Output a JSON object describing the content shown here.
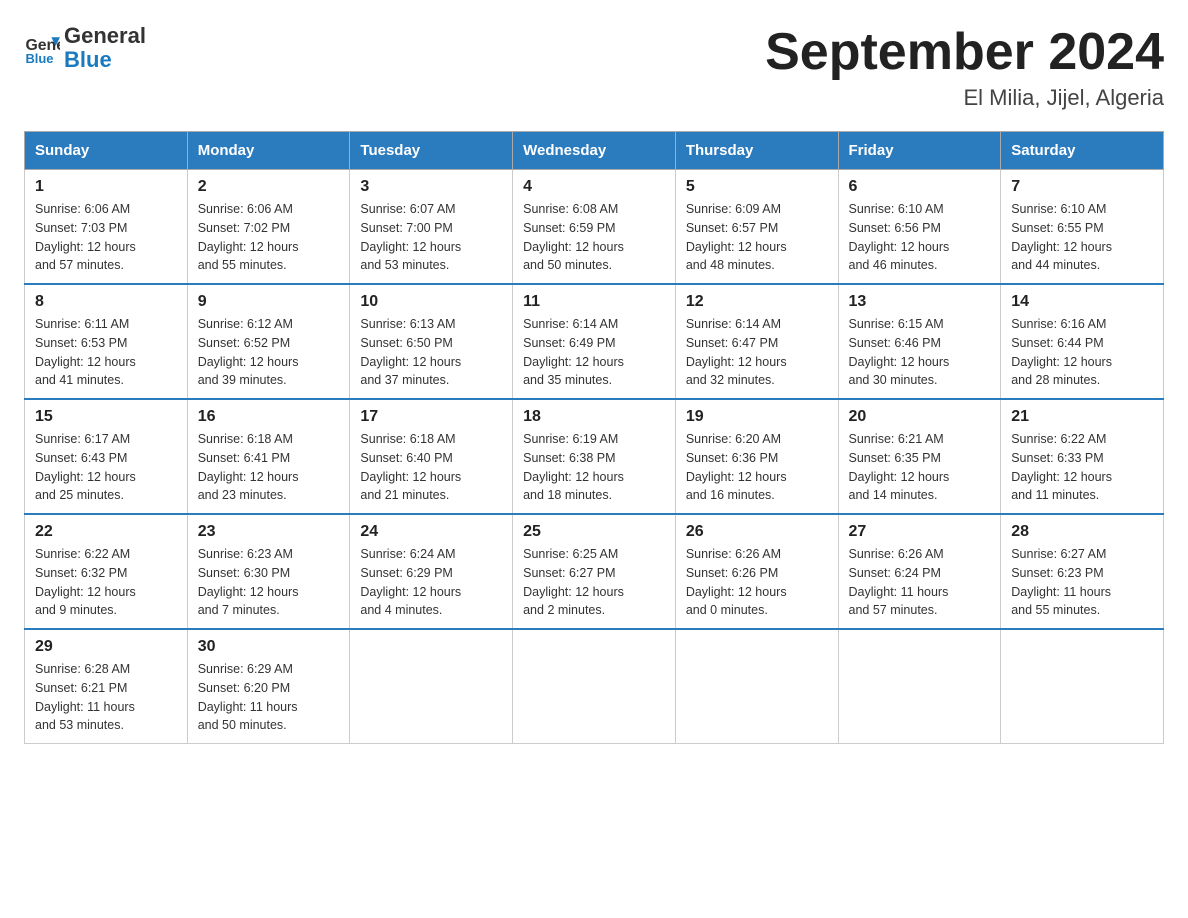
{
  "header": {
    "logo_line1": "General",
    "logo_line2": "Blue",
    "month_title": "September 2024",
    "location": "El Milia, Jijel, Algeria"
  },
  "days_of_week": [
    "Sunday",
    "Monday",
    "Tuesday",
    "Wednesday",
    "Thursday",
    "Friday",
    "Saturday"
  ],
  "weeks": [
    [
      {
        "day": "1",
        "sunrise": "6:06 AM",
        "sunset": "7:03 PM",
        "daylight": "12 hours and 57 minutes."
      },
      {
        "day": "2",
        "sunrise": "6:06 AM",
        "sunset": "7:02 PM",
        "daylight": "12 hours and 55 minutes."
      },
      {
        "day": "3",
        "sunrise": "6:07 AM",
        "sunset": "7:00 PM",
        "daylight": "12 hours and 53 minutes."
      },
      {
        "day": "4",
        "sunrise": "6:08 AM",
        "sunset": "6:59 PM",
        "daylight": "12 hours and 50 minutes."
      },
      {
        "day": "5",
        "sunrise": "6:09 AM",
        "sunset": "6:57 PM",
        "daylight": "12 hours and 48 minutes."
      },
      {
        "day": "6",
        "sunrise": "6:10 AM",
        "sunset": "6:56 PM",
        "daylight": "12 hours and 46 minutes."
      },
      {
        "day": "7",
        "sunrise": "6:10 AM",
        "sunset": "6:55 PM",
        "daylight": "12 hours and 44 minutes."
      }
    ],
    [
      {
        "day": "8",
        "sunrise": "6:11 AM",
        "sunset": "6:53 PM",
        "daylight": "12 hours and 41 minutes."
      },
      {
        "day": "9",
        "sunrise": "6:12 AM",
        "sunset": "6:52 PM",
        "daylight": "12 hours and 39 minutes."
      },
      {
        "day": "10",
        "sunrise": "6:13 AM",
        "sunset": "6:50 PM",
        "daylight": "12 hours and 37 minutes."
      },
      {
        "day": "11",
        "sunrise": "6:14 AM",
        "sunset": "6:49 PM",
        "daylight": "12 hours and 35 minutes."
      },
      {
        "day": "12",
        "sunrise": "6:14 AM",
        "sunset": "6:47 PM",
        "daylight": "12 hours and 32 minutes."
      },
      {
        "day": "13",
        "sunrise": "6:15 AM",
        "sunset": "6:46 PM",
        "daylight": "12 hours and 30 minutes."
      },
      {
        "day": "14",
        "sunrise": "6:16 AM",
        "sunset": "6:44 PM",
        "daylight": "12 hours and 28 minutes."
      }
    ],
    [
      {
        "day": "15",
        "sunrise": "6:17 AM",
        "sunset": "6:43 PM",
        "daylight": "12 hours and 25 minutes."
      },
      {
        "day": "16",
        "sunrise": "6:18 AM",
        "sunset": "6:41 PM",
        "daylight": "12 hours and 23 minutes."
      },
      {
        "day": "17",
        "sunrise": "6:18 AM",
        "sunset": "6:40 PM",
        "daylight": "12 hours and 21 minutes."
      },
      {
        "day": "18",
        "sunrise": "6:19 AM",
        "sunset": "6:38 PM",
        "daylight": "12 hours and 18 minutes."
      },
      {
        "day": "19",
        "sunrise": "6:20 AM",
        "sunset": "6:36 PM",
        "daylight": "12 hours and 16 minutes."
      },
      {
        "day": "20",
        "sunrise": "6:21 AM",
        "sunset": "6:35 PM",
        "daylight": "12 hours and 14 minutes."
      },
      {
        "day": "21",
        "sunrise": "6:22 AM",
        "sunset": "6:33 PM",
        "daylight": "12 hours and 11 minutes."
      }
    ],
    [
      {
        "day": "22",
        "sunrise": "6:22 AM",
        "sunset": "6:32 PM",
        "daylight": "12 hours and 9 minutes."
      },
      {
        "day": "23",
        "sunrise": "6:23 AM",
        "sunset": "6:30 PM",
        "daylight": "12 hours and 7 minutes."
      },
      {
        "day": "24",
        "sunrise": "6:24 AM",
        "sunset": "6:29 PM",
        "daylight": "12 hours and 4 minutes."
      },
      {
        "day": "25",
        "sunrise": "6:25 AM",
        "sunset": "6:27 PM",
        "daylight": "12 hours and 2 minutes."
      },
      {
        "day": "26",
        "sunrise": "6:26 AM",
        "sunset": "6:26 PM",
        "daylight": "12 hours and 0 minutes."
      },
      {
        "day": "27",
        "sunrise": "6:26 AM",
        "sunset": "6:24 PM",
        "daylight": "11 hours and 57 minutes."
      },
      {
        "day": "28",
        "sunrise": "6:27 AM",
        "sunset": "6:23 PM",
        "daylight": "11 hours and 55 minutes."
      }
    ],
    [
      {
        "day": "29",
        "sunrise": "6:28 AM",
        "sunset": "6:21 PM",
        "daylight": "11 hours and 53 minutes."
      },
      {
        "day": "30",
        "sunrise": "6:29 AM",
        "sunset": "6:20 PM",
        "daylight": "11 hours and 50 minutes."
      },
      null,
      null,
      null,
      null,
      null
    ]
  ],
  "labels": {
    "sunrise": "Sunrise:",
    "sunset": "Sunset:",
    "daylight": "Daylight:"
  }
}
